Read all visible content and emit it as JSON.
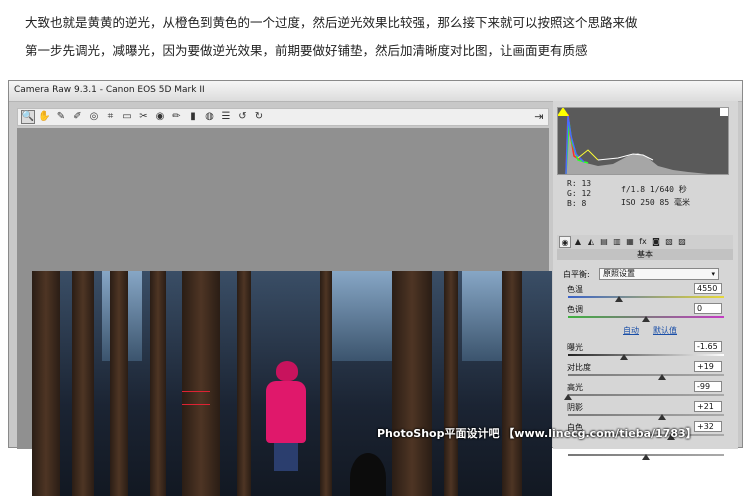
{
  "article": {
    "line1": "大致也就是黄黄的逆光，从橙色到黄色的一个过度，然后逆光效果比较强，那么接下来就可以按照这个思路来做",
    "line2": "第一步先调光，减曝光，因为要做逆光效果，前期要做好铺垫，然后加清晰度对比图，让画面更有质感"
  },
  "window": {
    "title": "Camera Raw 9.3.1 -  Canon EOS 5D Mark II"
  },
  "toolbar": {
    "tools": [
      {
        "name": "zoom-tool-icon",
        "glyph": "🔍"
      },
      {
        "name": "hand-tool-icon",
        "glyph": "✋"
      },
      {
        "name": "white-balance-tool-icon",
        "glyph": "✎"
      },
      {
        "name": "color-sampler-tool-icon",
        "glyph": "✐"
      },
      {
        "name": "target-adjust-tool-icon",
        "glyph": "◎"
      },
      {
        "name": "crop-tool-icon",
        "glyph": "⌗"
      },
      {
        "name": "straighten-tool-icon",
        "glyph": "▭"
      },
      {
        "name": "spot-removal-tool-icon",
        "glyph": "✂"
      },
      {
        "name": "red-eye-tool-icon",
        "glyph": "◉"
      },
      {
        "name": "adjustment-brush-icon",
        "glyph": "✏"
      },
      {
        "name": "graduated-filter-icon",
        "glyph": "▮"
      },
      {
        "name": "radial-filter-icon",
        "glyph": "◍"
      },
      {
        "name": "preferences-icon",
        "glyph": "☰"
      },
      {
        "name": "rotate-left-icon",
        "glyph": "↺"
      },
      {
        "name": "rotate-right-icon",
        "glyph": "↻"
      }
    ],
    "export_glyph": "⇥"
  },
  "readout": {
    "r": "R:   13",
    "g": "G:   12",
    "b": "B:    8",
    "aperture_shutter": "f/1.8  1/640 秒",
    "iso_focal": "ISO 250  85 毫米"
  },
  "tabs": [
    "◉",
    "▲",
    "◭",
    "▤",
    "▥",
    "▦",
    "fx",
    "◙",
    "▧",
    "▨"
  ],
  "basic": {
    "section_title": "基本",
    "wb_label": "白平衡:",
    "wb_value": "原照设置",
    "wb_arrow": "▾",
    "auto_label": "自动",
    "default_label": "默认值",
    "sliders": [
      {
        "key": "temp",
        "label": "色温",
        "value": "4550",
        "pos": 0.33,
        "track": "linear-gradient(90deg,#3a62c8,#e6d83a)"
      },
      {
        "key": "tint",
        "label": "色调",
        "value": "0",
        "pos": 0.5,
        "track": "linear-gradient(90deg,#3fb13f,#c43cc4)"
      },
      {
        "key": "exposure",
        "label": "曝光",
        "value": "-1.65",
        "pos": 0.36,
        "track": "linear-gradient(90deg,#222,#fff)"
      },
      {
        "key": "contrast",
        "label": "对比度",
        "value": "+19",
        "pos": 0.6,
        "track": "linear-gradient(90deg,#777,#aaa)"
      },
      {
        "key": "highlights",
        "label": "高光",
        "value": "-99",
        "pos": 0.0,
        "track": "linear-gradient(90deg,#777,#aaa)"
      },
      {
        "key": "shadows",
        "label": "阴影",
        "value": "+21",
        "pos": 0.6,
        "track": "linear-gradient(90deg,#777,#aaa)"
      },
      {
        "key": "whites",
        "label": "白色",
        "value": "+32",
        "pos": 0.66,
        "track": "linear-gradient(90deg,#777,#aaa)"
      },
      {
        "key": "blacks",
        "label": "",
        "value": "",
        "pos": 0.5,
        "track": "linear-gradient(90deg,#777,#aaa)"
      }
    ]
  },
  "watermark": "PhotoShop平面设计吧 【www.linecg.com/tieba/1783】"
}
